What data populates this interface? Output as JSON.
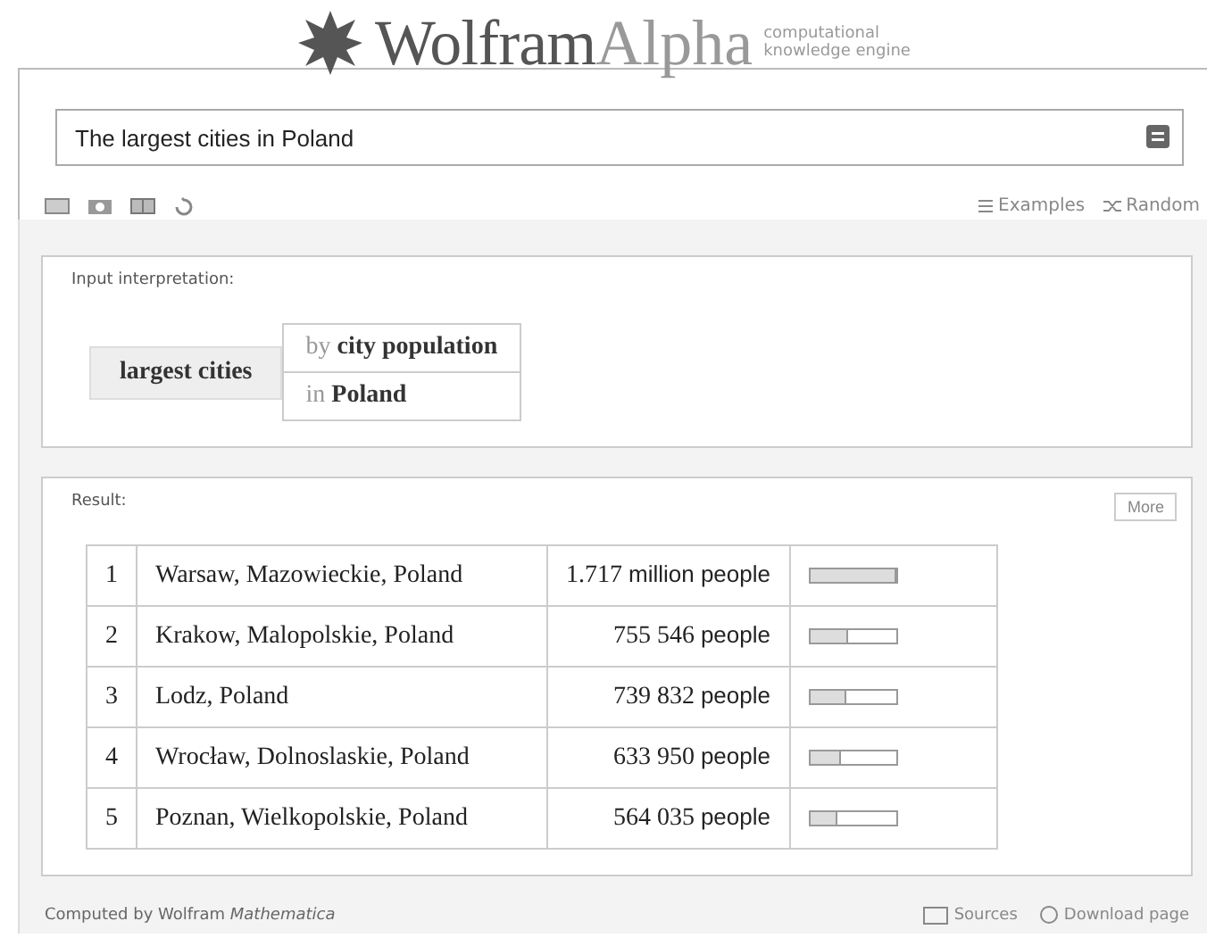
{
  "logo": {
    "name": "Wolfram",
    "name_accent": "Alpha",
    "tagline": [
      "computational",
      "knowledge engine"
    ]
  },
  "search": {
    "value": "The largest cities in Poland"
  },
  "links": [
    "Examples",
    "Random"
  ],
  "interpretation": {
    "title": "Input interpretation:",
    "main": "largest cities",
    "qualifiers": [
      {
        "prefix": "by",
        "value": "city population"
      },
      {
        "prefix": "in",
        "value": "Poland"
      }
    ]
  },
  "result": {
    "title": "Result:",
    "more": "More",
    "rows": [
      {
        "rank": "1",
        "city": "Warsaw, Mazowieckie, Poland",
        "population": "1.717",
        "unit": "million people",
        "level": 1.0
      },
      {
        "rank": "2",
        "city": "Krakow, Malopolskie, Poland",
        "population": "755 546",
        "unit": "people",
        "level": 0.44
      },
      {
        "rank": "3",
        "city": "Lodz, Poland",
        "population": "739 832",
        "unit": "people",
        "level": 0.43
      },
      {
        "rank": "4",
        "city": "Wrocław, Dolnoslaskie, Poland",
        "population": "633 950",
        "unit": "people",
        "level": 0.37
      },
      {
        "rank": "5",
        "city": "Poznan, Wielkopolskie, Poland",
        "population": "564 035",
        "unit": "people",
        "level": 0.33
      }
    ]
  },
  "footer": {
    "computed_by": "Computed by Wolfram *Mathematica*",
    "sources": "Sources",
    "download": "Download page"
  }
}
